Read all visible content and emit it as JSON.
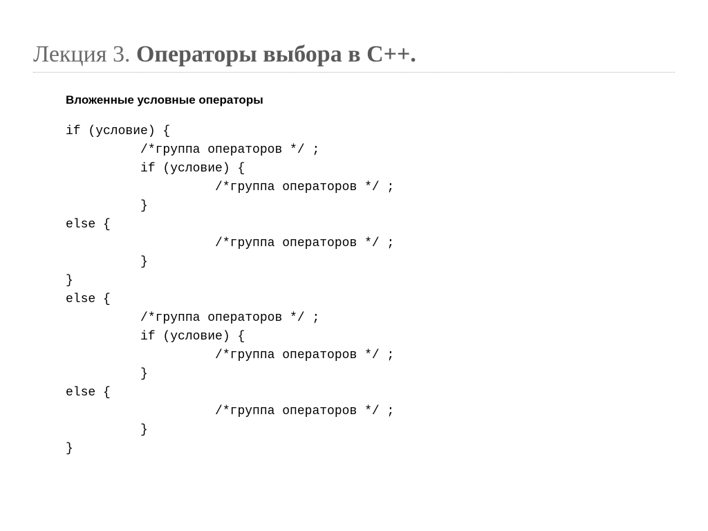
{
  "title": {
    "prefix": "Лекция 3. ",
    "bold": "Операторы выбора в С++."
  },
  "subheading": "Вложенные условные операторы",
  "code_lines": [
    "if (условие) {",
    "          /*группа операторов */ ;",
    "          if (условие) {",
    "                    /*группа операторов */ ;",
    "          }",
    "else {",
    "                    /*группа операторов */ ;",
    "          }",
    "}",
    "else {",
    "          /*группа операторов */ ;",
    "          if (условие) {",
    "                    /*группа операторов */ ;",
    "          }",
    "else {",
    "                    /*группа операторов */ ;",
    "          }",
    "}"
  ]
}
